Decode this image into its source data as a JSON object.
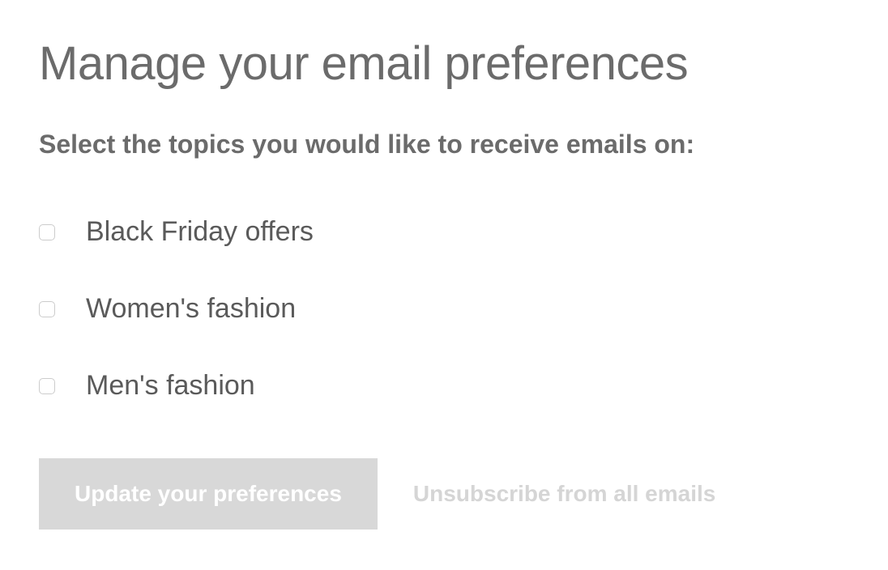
{
  "header": {
    "title": "Manage your email preferences",
    "subtitle": "Select the topics you would like to receive emails on:"
  },
  "topics": [
    {
      "label": "Black Friday offers",
      "checked": false
    },
    {
      "label": "Women's fashion",
      "checked": false
    },
    {
      "label": "Men's fashion",
      "checked": false
    }
  ],
  "actions": {
    "update_label": "Update your preferences",
    "unsubscribe_label": "Unsubscribe from all emails"
  }
}
